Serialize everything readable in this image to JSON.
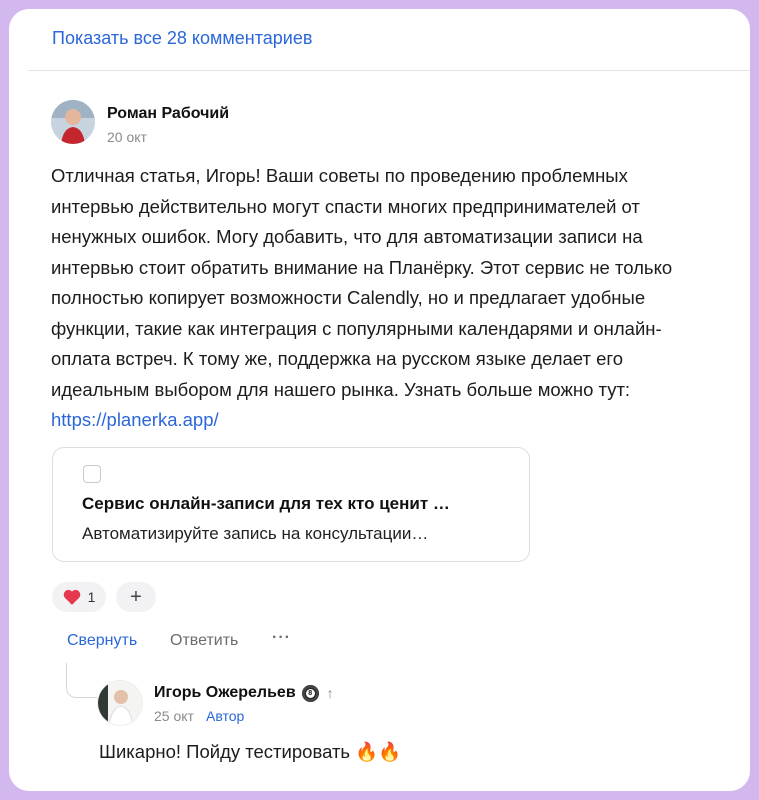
{
  "show_all_link": "Показать все 28 комментариев",
  "comment": {
    "author": "Роман Рабочий",
    "date": "20 окт",
    "text": "Отличная статья, Игорь! Ваши советы по проведению проблемных интервью действительно могут спасти многих предпринимателей от ненужных ошибок. Могу добавить, что для автоматизации записи на интервью стоит обратить внимание на Планёрку. Этот сервис не только полностью копирует возможности Calendly, но и предлагает удобные функции, такие как интеграция с популярными календарями и онлайн-оплата встреч. К тому же, поддержка на русском языке делает его идеальным выбором для нашего рынка. Узнать больше можно тут: ",
    "link": "https://planerka.app/",
    "link_preview": {
      "title": "Сервис онлайн-записи для тех кто ценит …",
      "description": "Автоматизируйте запись на консультации…"
    },
    "reactions": {
      "heart_count": "1",
      "add_label": "+"
    },
    "actions": {
      "collapse": "Свернуть",
      "reply": "Ответить",
      "more": "···"
    }
  },
  "reply": {
    "author": "Игорь Ожерельев",
    "badge": "8",
    "arrow": "↑",
    "date": "25 окт",
    "tag": "Автор",
    "text": "Шикарно! Пойду тестировать 🔥🔥"
  },
  "colors": {
    "background": "#d3b8f0",
    "link": "#2a67d9",
    "heart": "#e5394f"
  }
}
